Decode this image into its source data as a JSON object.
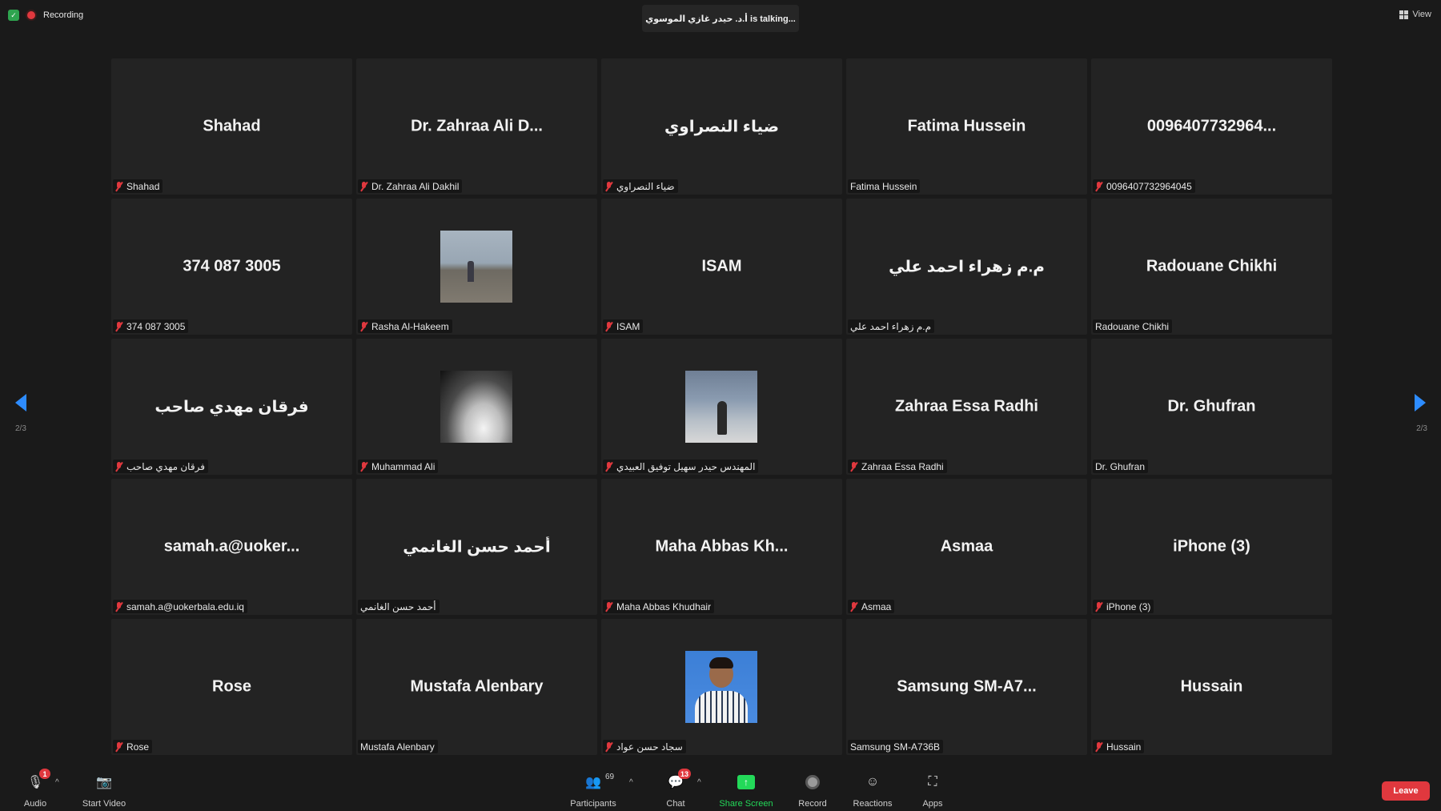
{
  "top": {
    "recording_label": "Recording",
    "talking_text": "أ.د. حيدر غازي الموسوي is  talking...",
    "view_label": "View"
  },
  "nav": {
    "page_left": "2/3",
    "page_right": "2/3"
  },
  "tiles": [
    {
      "big": "Shahad",
      "name": "Shahad"
    },
    {
      "big": "Dr. Zahraa Ali  D...",
      "name": "Dr. Zahraa Ali  Dakhil"
    },
    {
      "big": "ضياء النصراوي",
      "name": "ضياء النصراوي"
    },
    {
      "big": "Fatima Hussein",
      "name": "Fatima Hussein"
    },
    {
      "big": "0096407732964...",
      "name": "0096407732964045"
    },
    {
      "big": "374 087 3005",
      "name": "374 087 3005"
    },
    {
      "big": "",
      "name": "Rasha Al-Hakeem"
    },
    {
      "big": "ISAM",
      "name": "ISAM"
    },
    {
      "big": "م.م زهراء احمد علي",
      "name": "م.م زهراء احمد علي"
    },
    {
      "big": "Radouane Chikhi",
      "name": "Radouane Chikhi"
    },
    {
      "big": "فرقان مهدي صاحب",
      "name": "فرقان مهدي صاحب"
    },
    {
      "big": "",
      "name": "Muhammad Ali"
    },
    {
      "big": "",
      "name": "المهندس حيدر سهيل توفيق العبيدي"
    },
    {
      "big": "Zahraa Essa Radhi",
      "name": "Zahraa Essa Radhi"
    },
    {
      "big": "Dr. Ghufran",
      "name": "Dr. Ghufran"
    },
    {
      "big": "samah.a@uoker...",
      "name": "samah.a@uokerbala.edu.iq"
    },
    {
      "big": "أحمد حسن الغانمي",
      "name": "أحمد حسن الغانمي"
    },
    {
      "big": "Maha Abbas Kh...",
      "name": "Maha Abbas Khudhair"
    },
    {
      "big": "Asmaa",
      "name": "Asmaa"
    },
    {
      "big": "iPhone (3)",
      "name": "iPhone (3)"
    },
    {
      "big": "Rose",
      "name": "Rose"
    },
    {
      "big": "Mustafa Alenbary",
      "name": "Mustafa Alenbary"
    },
    {
      "big": "",
      "name": "سجاد حسن عواد"
    },
    {
      "big": "Samsung  SM-A7...",
      "name": "Samsung SM-A736B"
    },
    {
      "big": "Hussain",
      "name": "Hussain"
    }
  ],
  "toolbar": {
    "audio": "Audio",
    "audio_badge": "1",
    "start_video": "Start Video",
    "participants": "Participants",
    "participants_count": "69",
    "chat": "Chat",
    "chat_badge": "13",
    "share_screen": "Share Screen",
    "record": "Record",
    "reactions": "Reactions",
    "apps": "Apps",
    "leave": "Leave"
  }
}
